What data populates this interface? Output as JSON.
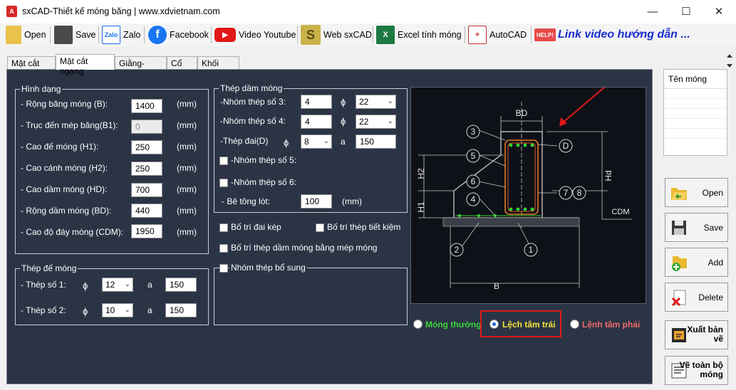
{
  "window": {
    "title": "sxCAD-Thiết kế móng băng | www.xdvietnam.com",
    "min": "—",
    "max": "☐",
    "close": "✕"
  },
  "toolbar": {
    "open": "Open",
    "save": "Save",
    "zalo": "Zalo",
    "facebook": "Facebook",
    "youtube": "Video Youtube",
    "web": "Web sxCAD",
    "excel": "Excel tính móng",
    "autocad": "AutoCAD",
    "help_badge": "HELP!",
    "link": "Link video hướng dẫn ...",
    "zalo_icon_text": "Zalo",
    "web_icon_text": "S",
    "excel_icon_text": "X"
  },
  "tabs": [
    "Mặt cắt dọc",
    "Mặt cắt ngang",
    "Giằng-Tường",
    "Cổ cột",
    "Khối lượng"
  ],
  "hinh_dang": {
    "title": "Hình dạng",
    "rows": [
      {
        "label": "- Rộng băng móng (B):",
        "value": "1400",
        "unit": "(mm)"
      },
      {
        "label": "- Trục đến mép băng(B1):",
        "value": "0",
        "unit": "(mm)"
      },
      {
        "label": "- Cao đế móng (H1):",
        "value": "250",
        "unit": "(mm)"
      },
      {
        "label": "- Cao cánh móng (H2):",
        "value": "250",
        "unit": "(mm)"
      },
      {
        "label": "- Cao dầm móng (HD):",
        "value": "700",
        "unit": "(mm)"
      },
      {
        "label": "- Rộng dầm móng (BD):",
        "value": "440",
        "unit": "(mm)"
      },
      {
        "label": "- Cao độ đáy móng (CDM):",
        "value": "1950",
        "unit": "(mm)"
      }
    ]
  },
  "thep_de_mong": {
    "title": "Thép đế móng",
    "phi": "ϕ",
    "a": "a",
    "rows": [
      {
        "label": "- Thép số 1:",
        "dia": "12",
        "spacing": "150"
      },
      {
        "label": "- Thép số 2:",
        "dia": "10",
        "spacing": "150"
      }
    ]
  },
  "thep_dam_mong": {
    "title": "Thép dầm móng",
    "phi": "ϕ",
    "a": "a",
    "g3_label": "-Nhóm thép số 3:",
    "g3_count": "4",
    "g3_dia": "22",
    "g4_label": "-Nhóm thép số 4:",
    "g4_count": "4",
    "g4_dia": "22",
    "dai_label": "-Thép đai(D)",
    "dai_dia": "8",
    "dai_spacing": "150",
    "g5_label": "-Nhóm thép số 5:",
    "g6_label": "-Nhóm thép số 6:",
    "betong_label": "- Bê tông lót:",
    "betong_value": "100",
    "betong_unit": "(mm)"
  },
  "options": {
    "dai_kep": "Bố trí đai kép",
    "tiet_kiem": "Bố trí thép tiết kiệm",
    "bang_mep": "Bố trí thép dầm móng bằng mép móng",
    "bo_sung": "Nhóm thép bổ sung"
  },
  "radios": {
    "thuong": "Móng thường",
    "trai": "Lệch tâm trái",
    "phai": "Lệnh tâm phải"
  },
  "drawing": {
    "BD": "BD",
    "B": "B",
    "D": "D",
    "H1": "H1",
    "H2": "H2",
    "Hd": "Hd",
    "CDM": "CDM",
    "n1": "1",
    "n2": "2",
    "n3": "3",
    "n4": "4",
    "n5": "5",
    "n6": "6",
    "n7": "7",
    "n8": "8"
  },
  "right_panel": {
    "list_header": "Tên móng",
    "open": "Open",
    "save": "Save",
    "add": "Add",
    "delete": "Delete",
    "export": "Xuất bản vẽ",
    "draw_all": "Vẽ toàn bộ móng"
  },
  "colors": {
    "panel": "#2b3445",
    "radio_thuong": "#3ad43a",
    "radio_trai": "#f5e13a",
    "radio_phai": "#f06a6a",
    "highlight": "#e01818",
    "link": "#1a2ccf"
  }
}
